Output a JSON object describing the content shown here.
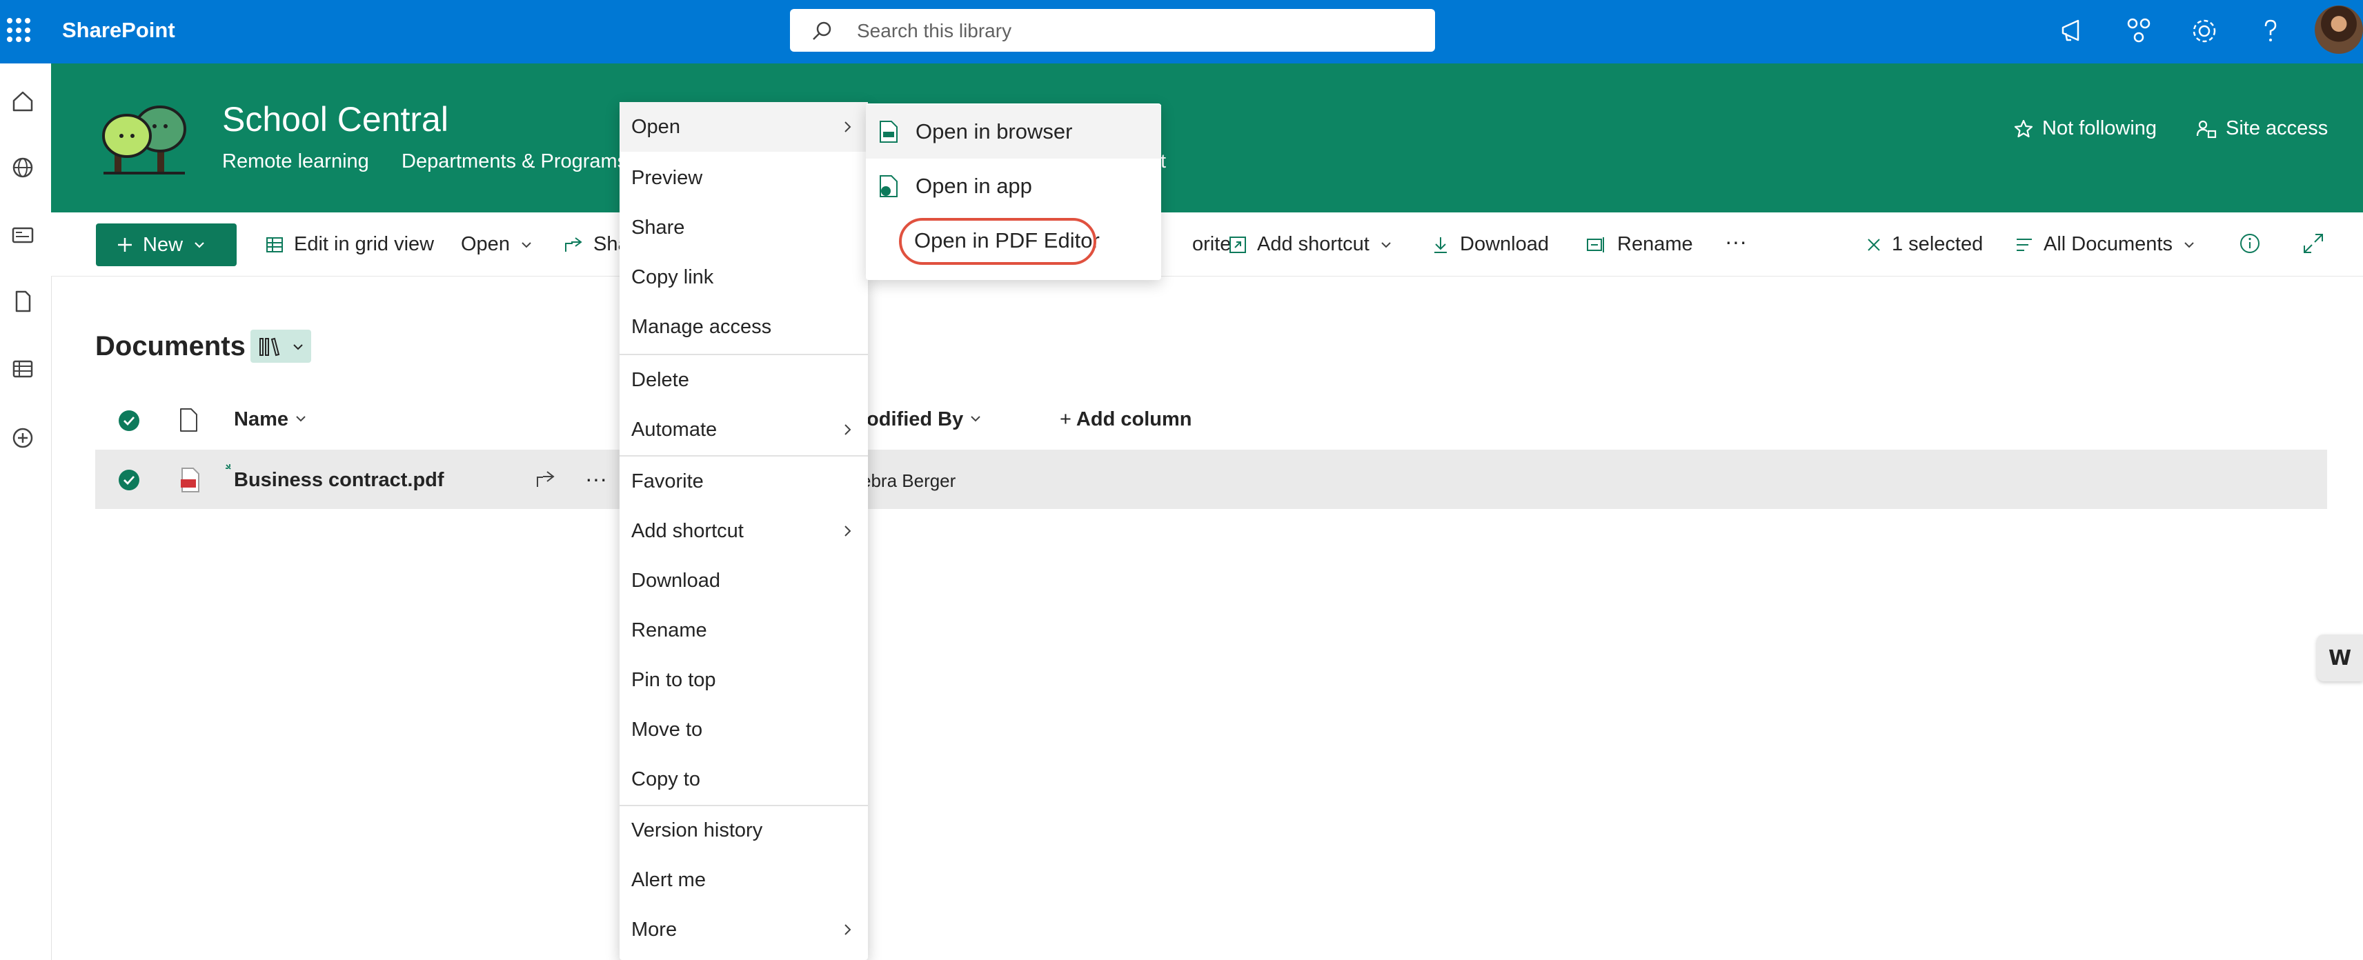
{
  "topbar": {
    "app_name": "SharePoint",
    "search_placeholder": "Search this library",
    "icons": [
      "app-launcher-icon",
      "megaphone-icon",
      "share-icon",
      "gear-icon",
      "help-icon"
    ],
    "accent": "#0078d4"
  },
  "rail": {
    "icons": [
      "home-icon",
      "globe-icon",
      "news-icon",
      "file-icon",
      "list-icon",
      "add-circle-icon"
    ]
  },
  "site": {
    "title": "School Central",
    "nav": [
      "Remote learning",
      "Departments & Programs"
    ],
    "nav_partial": "t",
    "not_following": "Not following",
    "site_access": "Site access",
    "color": "#0d8563"
  },
  "commandbar": {
    "new": "New",
    "edit_grid": "Edit in grid view",
    "open": "Open",
    "share_partial": "Sha",
    "favorite_partial": "orite",
    "add_shortcut": "Add shortcut",
    "download": "Download",
    "rename": "Rename",
    "more": "···",
    "selected": "1 selected",
    "view": "All Documents"
  },
  "library": {
    "title": "Documents",
    "columns": {
      "name": "Name",
      "modified_by": "lodified By",
      "add_column": "Add column"
    },
    "rows": [
      {
        "name": "Business contract.pdf",
        "modified_by": "ebra Berger"
      }
    ]
  },
  "context_menu": {
    "items": [
      "Open",
      "Preview",
      "Share",
      "Copy link",
      "Manage access",
      "Delete",
      "Automate",
      "Favorite",
      "Add shortcut",
      "Download",
      "Rename",
      "Pin to top",
      "Move to",
      "Copy to",
      "Version history",
      "Alert me",
      "More"
    ]
  },
  "open_submenu": {
    "items": [
      "Open in browser",
      "Open in app",
      "Open in PDF Editor"
    ],
    "highlight_color": "#e0513f"
  },
  "side_tab": {
    "label": "W"
  }
}
